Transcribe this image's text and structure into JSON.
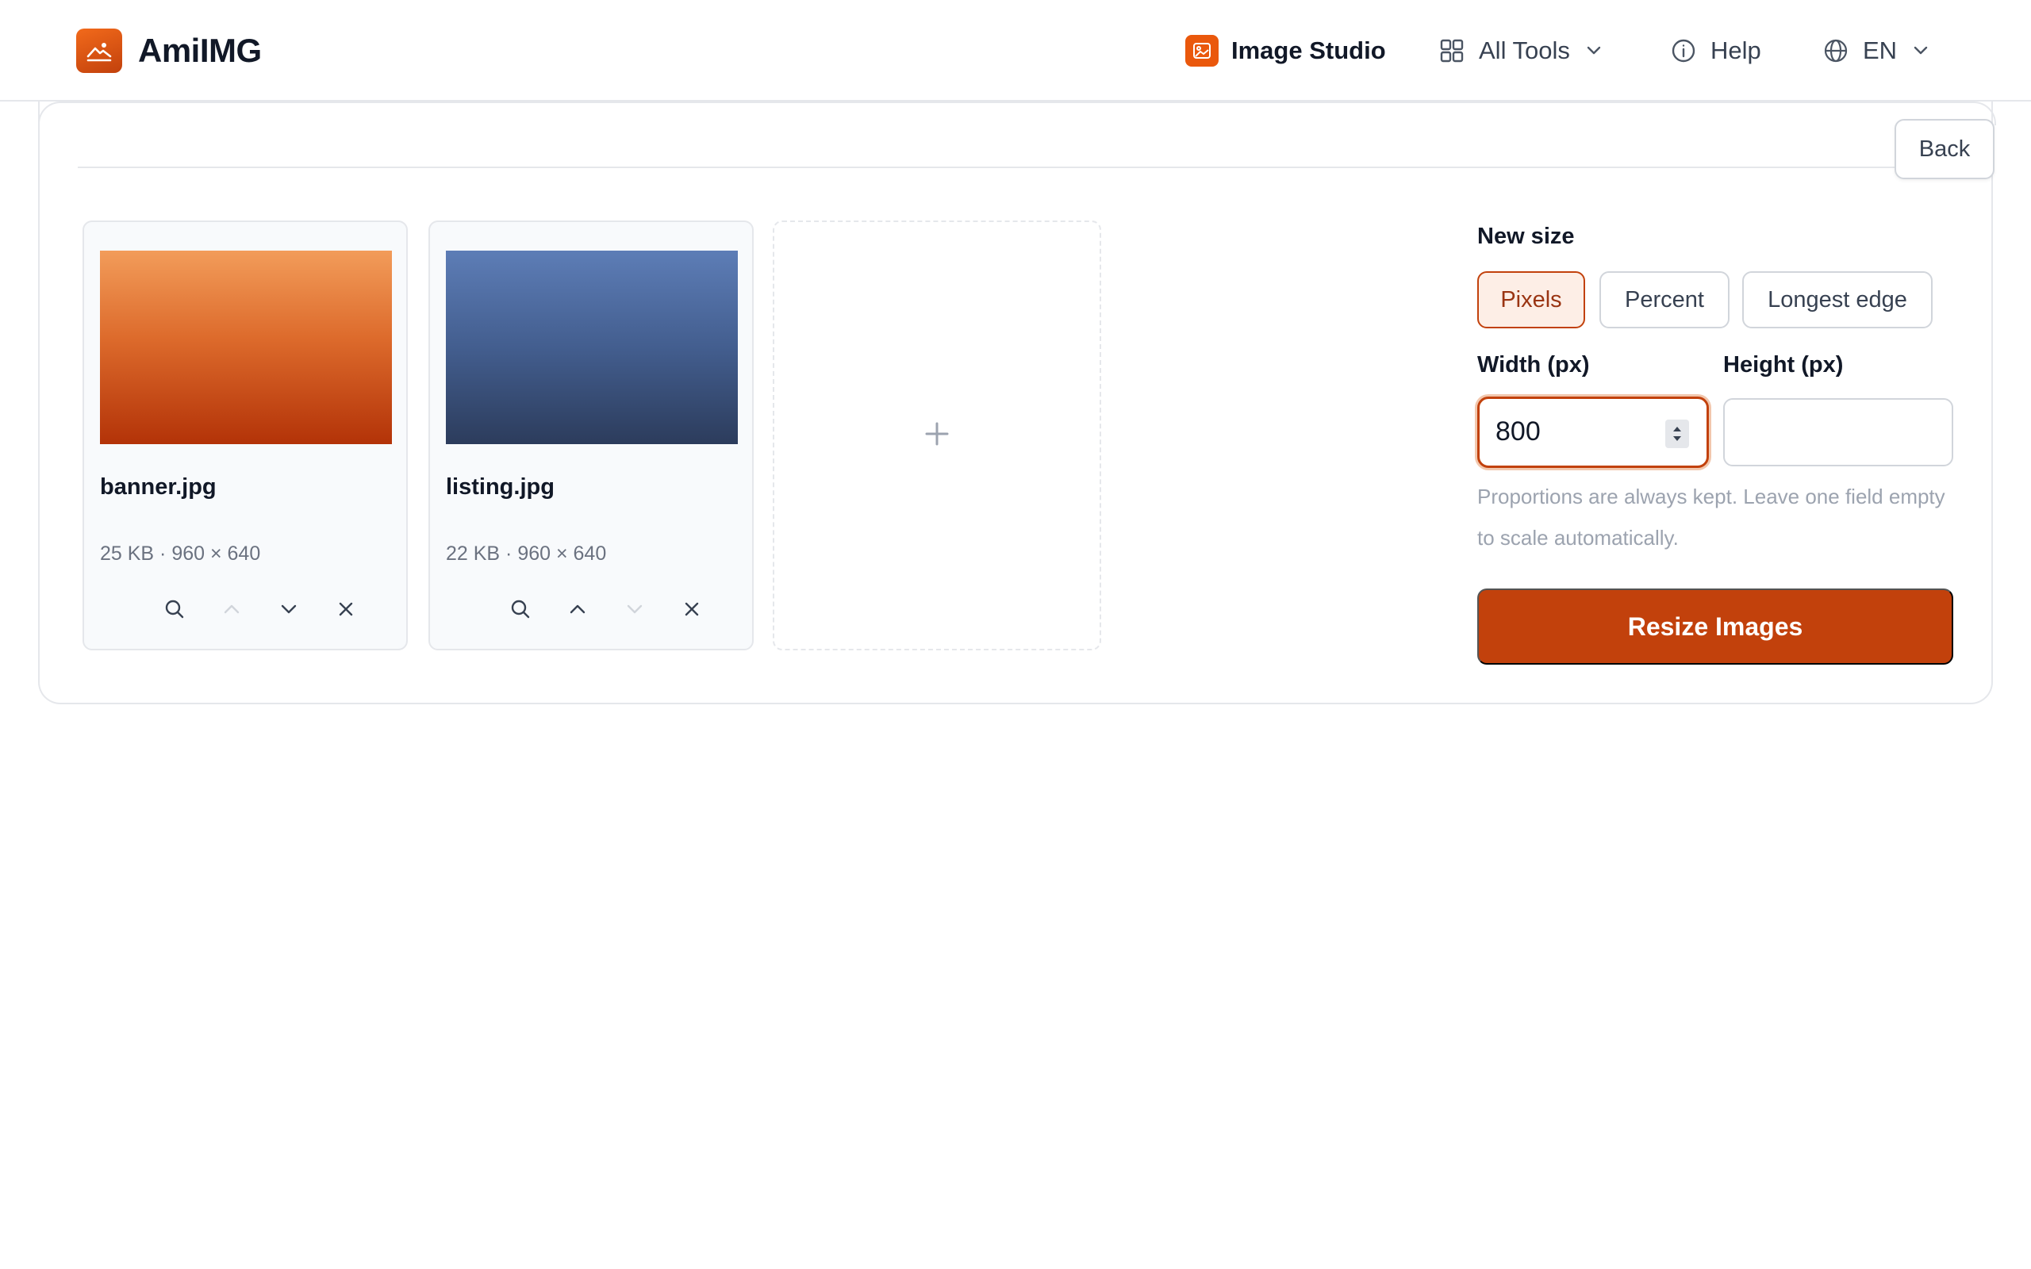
{
  "brand": {
    "name": "AmiIMG",
    "logo_icon": "mountain-sun-icon",
    "accent": "#ea580c"
  },
  "nav": {
    "studio": "Image Studio",
    "all_tools": "All Tools",
    "help": "Help",
    "language": "EN"
  },
  "toolbar": {
    "back": "Back"
  },
  "files": [
    {
      "name": "banner.jpg",
      "meta": "25 KB · 960 × 640",
      "thumb_colors": [
        "#f29c5a",
        "#b33308"
      ]
    },
    {
      "name": "listing.jpg",
      "meta": "22 KB · 960 × 640",
      "thumb_colors": [
        "#5d7db6",
        "#2c3c5c"
      ]
    }
  ],
  "tile_actions": [
    "zoom-icon",
    "move-up-icon",
    "move-down-icon",
    "remove-icon"
  ],
  "add_tile": {
    "icon": "plus-icon"
  },
  "settings": {
    "new_size_label": "New size",
    "modes": [
      "Pixels",
      "Percent",
      "Longest edge"
    ],
    "selected_mode": "Pixels",
    "width_label": "Width (px)",
    "height_label": "Height (px)",
    "width_value": "800",
    "height_value": "",
    "hint": "Proportions are always kept. Leave one field empty to scale automatically.",
    "submit": "Resize Images"
  }
}
